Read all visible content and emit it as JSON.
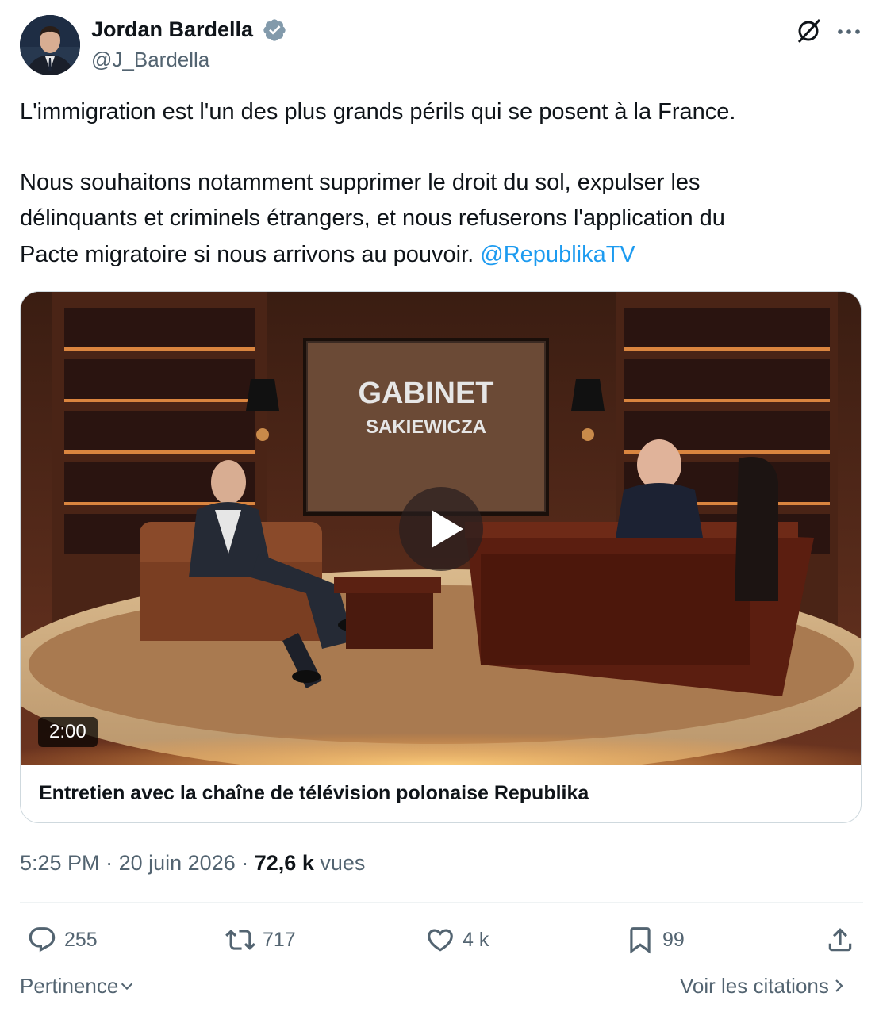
{
  "author": {
    "name": "Jordan Bardella",
    "handle": "@J_Bardella",
    "verified": true,
    "avatar_icon": "profile-photo"
  },
  "tweet": {
    "line1": "L'immigration est l'un des plus grands périls qui se posent à la France.",
    "line2": "Nous souhaitons notamment supprimer le droit du sol, expulser les",
    "line3": "délinquants et criminels étrangers, et nous refuserons l'application du",
    "line4": "Pacte migratoire si nous arrivons au pouvoir.",
    "mention": "@RepublikaTV"
  },
  "media": {
    "duration": "2:00",
    "title": "Entretien avec la chaîne de télévision polonaise Republika",
    "screen_text_1": "GABINET",
    "screen_text_2": "SAKIEWICZA"
  },
  "meta": {
    "time": "5:25 PM",
    "separator": "·",
    "date": "20 juin 2026",
    "views_count": "72,6 k",
    "views_label": "vues"
  },
  "actions": {
    "replies": "255",
    "retweets": "717",
    "likes": "4 k",
    "bookmarks": "99"
  },
  "footer": {
    "sort_label": "Pertinence",
    "quotes_label": "Voir les citations"
  },
  "colors": {
    "accent": "#1d9bf0",
    "secondary_text": "#536471",
    "border": "#cfd9de"
  }
}
